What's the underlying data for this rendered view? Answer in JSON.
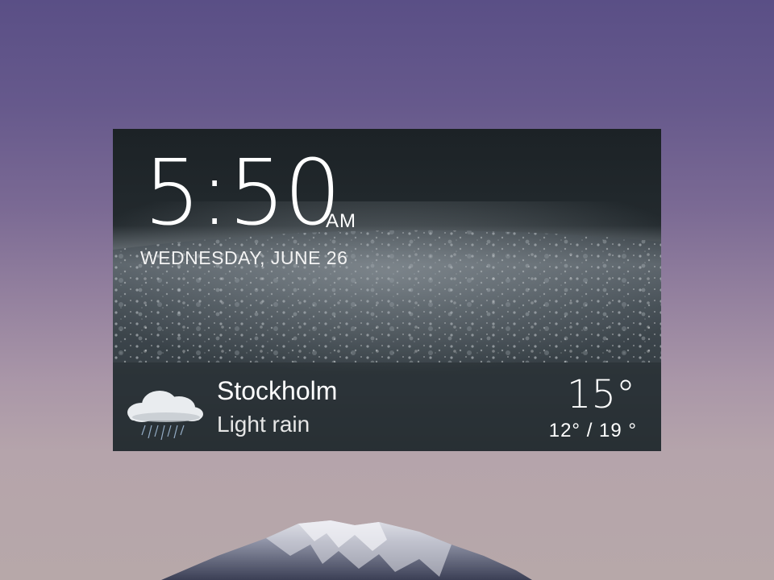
{
  "clock": {
    "time": "5:50",
    "ampm": "AM",
    "date": "WEDNESDAY, JUNE 26"
  },
  "weather": {
    "city": "Stockholm",
    "condition": "Light rain",
    "icon": "rain-cloud-icon",
    "current_temp": "15°",
    "range": "12° / 19 °"
  },
  "colors": {
    "wallpaper_top": "#5a4f86",
    "wallpaper_bottom": "#b7a8a9",
    "widget_bg": "#1b1f22",
    "text": "#ffffff"
  }
}
